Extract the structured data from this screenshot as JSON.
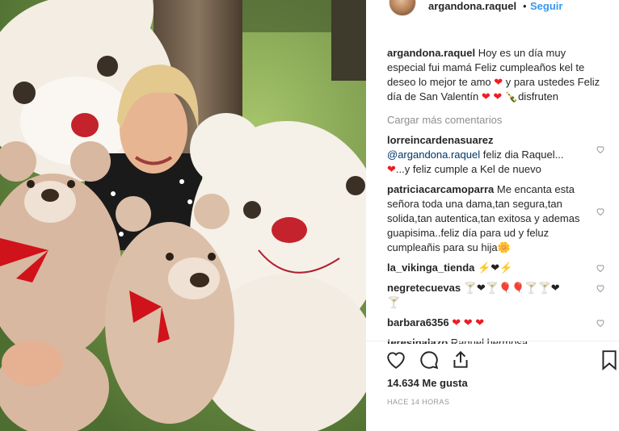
{
  "post": {
    "username": "argandona.raquel",
    "separator": "•",
    "follow_label": "Seguir",
    "caption_user": "argandona.raquel",
    "caption_text_1": " Hoy es un día muy especial fui mamá Feliz cumpleaños kel te deseo lo mejor te amo ",
    "caption_text_2": "y para ustedes Feliz día de San Valentín ",
    "caption_text_3": "disfruten",
    "load_more": "Cargar más comentarios",
    "likes": "14.634 Me gusta",
    "timestamp": "HACE 14 HORAS"
  },
  "comments": [
    {
      "user": "lorreincardenasuarez",
      "mention": "@argandona.raquel",
      "text_1": " feliz dia Raquel...",
      "text_2": "...y feliz cumple a Kel de nuevo"
    },
    {
      "user": "patriciacarcamoparra",
      "text": " Me encanta esta señora toda una dama,tan segura,tan solida,tan autentica,tan exitosa y ademas guapisima..feliz día para ud y feluz cumpleañis para su hija"
    },
    {
      "user": "la_vikinga_tienda",
      "text": ""
    },
    {
      "user": "negretecuevas",
      "text": ""
    },
    {
      "user": "barbara6356",
      "text": ""
    },
    {
      "user": "teresinalazo",
      "text": " Raquel hermosa"
    }
  ],
  "icons": {
    "like": "heart-outline-icon",
    "comment": "comment-bubble-icon",
    "share": "share-icon",
    "save": "bookmark-icon",
    "comment_like": "small-heart-icon"
  },
  "colors": {
    "link": "#3897f0",
    "mention": "#003569",
    "muted": "#8e8e8e",
    "heart": "#ed1c24"
  }
}
